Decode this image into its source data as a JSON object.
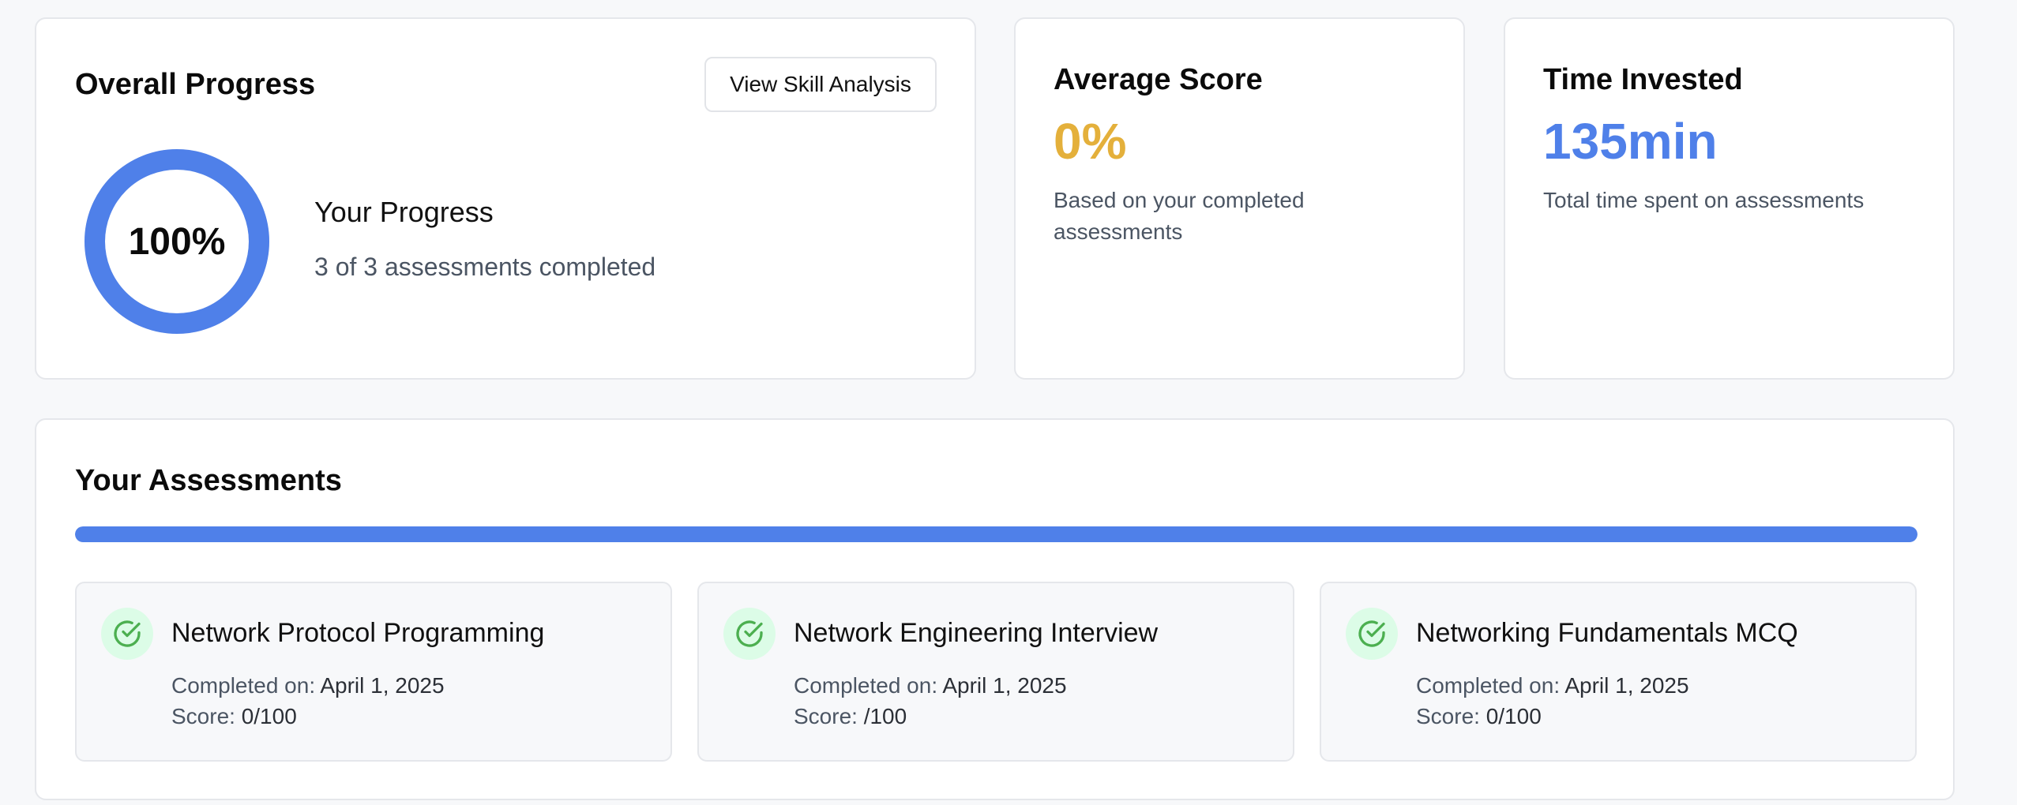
{
  "overall": {
    "title": "Overall Progress",
    "button_label": "View Skill Analysis",
    "percent_label": "100%",
    "percent_value": 100,
    "progress_heading": "Your Progress",
    "progress_sub": "3 of 3 assessments completed"
  },
  "average": {
    "title": "Average Score",
    "value": "0%",
    "desc": "Based on your completed assessments"
  },
  "time": {
    "title": "Time Invested",
    "value": "135min",
    "desc": "Total time spent on assessments"
  },
  "assessments": {
    "title": "Your Assessments",
    "progress_fraction": 1.0,
    "items": [
      {
        "name": "Network Protocol Programming",
        "completed_label": "Completed on: ",
        "completed_date": "April 1, 2025",
        "score_label": "Score: ",
        "score": "0/100"
      },
      {
        "name": "Network Engineering Interview",
        "completed_label": "Completed on: ",
        "completed_date": "April 1, 2025",
        "score_label": "Score: ",
        "score": "/100"
      },
      {
        "name": "Networking Fundamentals MCQ",
        "completed_label": "Completed on: ",
        "completed_date": "April 1, 2025",
        "score_label": "Score: ",
        "score": "0/100"
      }
    ]
  },
  "colors": {
    "accent_blue": "#4f80e9",
    "score_yellow": "#e4b03b",
    "success_green": "#4caf50",
    "success_bg": "#dcfce7"
  },
  "icons": {
    "check": "check-circle-icon"
  }
}
